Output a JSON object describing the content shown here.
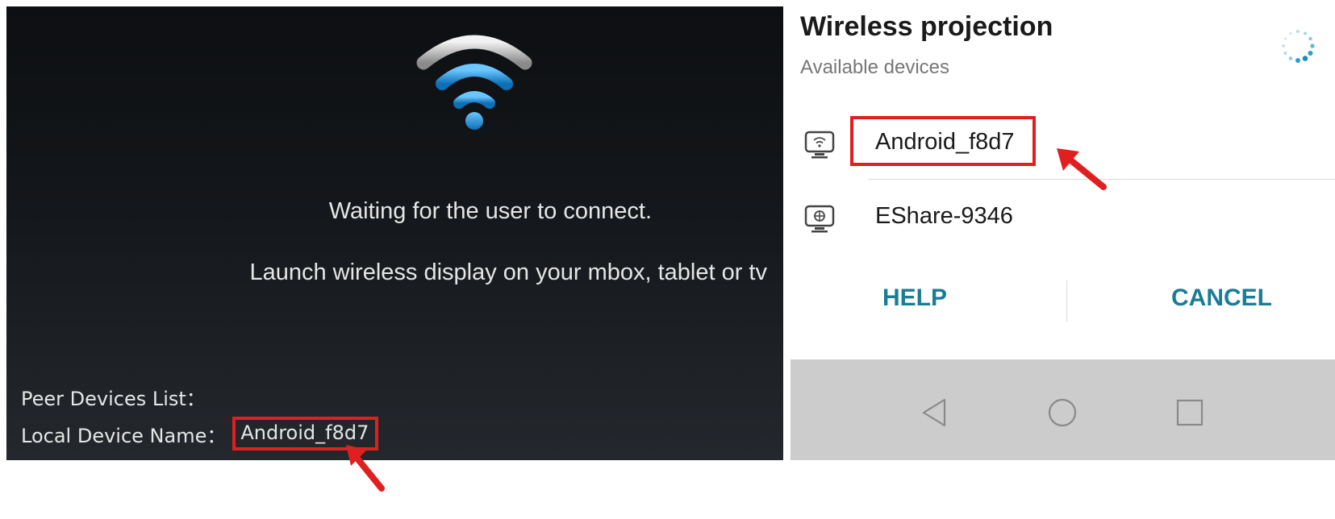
{
  "left_screen": {
    "waiting_text": "Waiting for the user to connect.",
    "launch_text": "Launch wireless display on your mbox, tablet or tv",
    "peer_devices_label": "Peer Devices List：",
    "local_device_label": "Local Device Name：",
    "local_device_name": "Android_f8d7",
    "icon": "wifi-icon"
  },
  "dialog": {
    "title": "Wireless projection",
    "subtitle": "Available devices",
    "devices": [
      {
        "name": "Android_f8d7",
        "icon": "cast-screen-icon"
      },
      {
        "name": "EShare-9346",
        "icon": "cast-screen-icon"
      }
    ],
    "buttons": {
      "help": "HELP",
      "cancel": "CANCEL"
    }
  },
  "nav_bar": {
    "icons": [
      "back-icon",
      "home-icon",
      "recent-apps-icon"
    ]
  },
  "colors": {
    "highlight": "#e02020",
    "accent": "#1a7c96",
    "wifi_blue": "#1e8fd8"
  }
}
